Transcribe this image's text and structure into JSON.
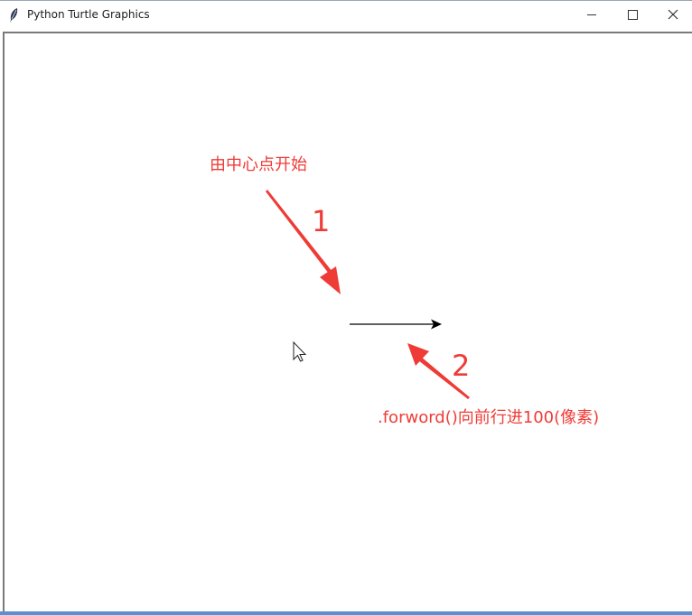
{
  "window": {
    "title": "Python Turtle Graphics",
    "icon": "feather-icon",
    "controls": {
      "minimize": "minimize-icon",
      "maximize": "maximize-icon",
      "close": "close-icon"
    }
  },
  "canvas": {
    "background": "#ffffff",
    "turtle_line_color": "#000000",
    "annotation_color": "#ef3b36"
  },
  "annotations": {
    "start_label": "由中心点开始",
    "step1_number": "1",
    "step2_number": "2",
    "forward_label": ".forword()向前行进100(像素)"
  }
}
